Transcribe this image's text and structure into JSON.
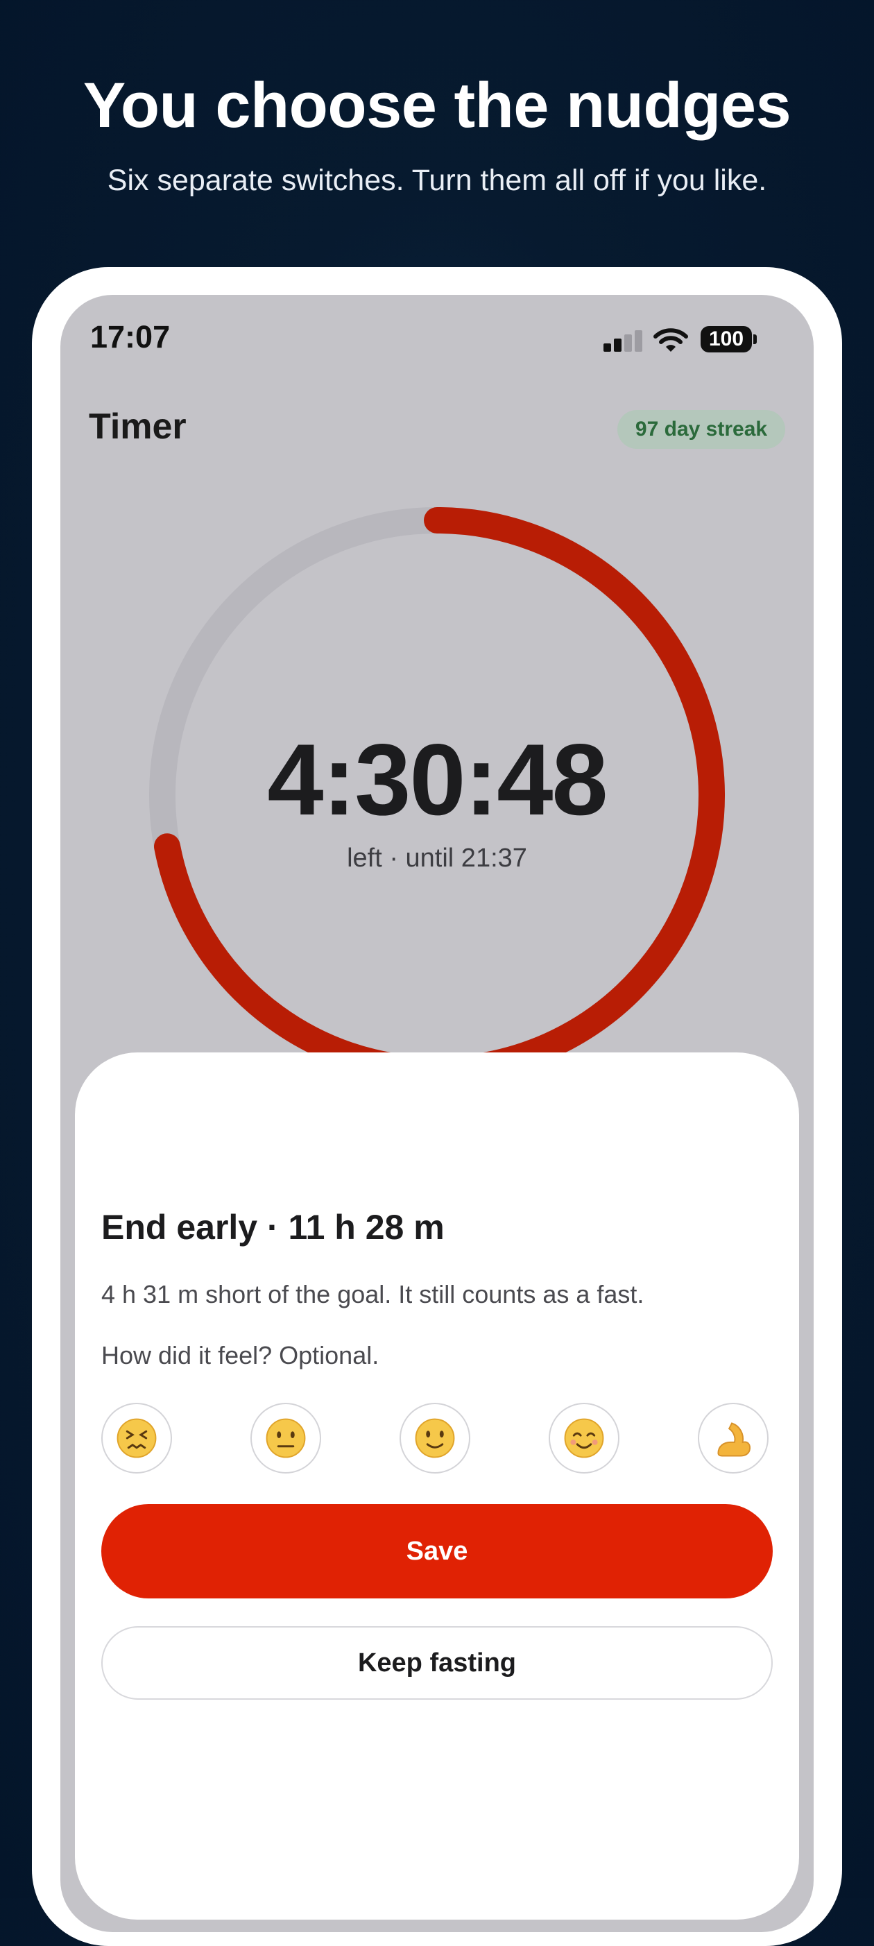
{
  "promo": {
    "headline": "You choose the nudges",
    "subline": "Six separate switches. Turn them all off if you like."
  },
  "status_bar": {
    "time": "17:07",
    "battery": "100",
    "signal_icon": "cellular-signal-icon",
    "wifi_icon": "wifi-icon"
  },
  "header": {
    "title": "Timer",
    "streak": "97 day streak"
  },
  "timer": {
    "remaining": "4:30:48",
    "subtitle": "left · until 21:37",
    "progress_elapsed_fraction": 0.72,
    "ring_color": "#b81d05",
    "track_color": "#b8b7bd"
  },
  "sheet": {
    "title": "End early · 11 h 28 m",
    "description": "4 h 31 m short of the goal. It still counts as a fast.",
    "question": "How did it feel? Optional.",
    "feelings": [
      {
        "icon": "confounded-face-icon"
      },
      {
        "icon": "neutral-face-icon"
      },
      {
        "icon": "slightly-smiling-face-icon"
      },
      {
        "icon": "smiling-face-icon"
      },
      {
        "icon": "flexed-biceps-icon"
      }
    ],
    "save_label": "Save",
    "keep_label": "Keep fasting",
    "accent": "#e02204"
  }
}
